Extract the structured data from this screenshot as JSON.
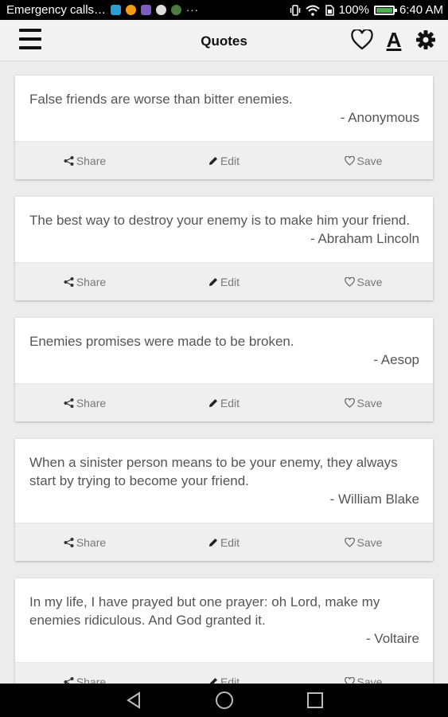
{
  "status_bar": {
    "notification_text": "Emergency calls…",
    "more": "···",
    "battery": "100%",
    "time": "6:40 AM",
    "battery_level": 1.0
  },
  "app_bar": {
    "title": "Quotes",
    "icons": [
      "menu-icon",
      "heart-icon",
      "font-icon",
      "gear-icon"
    ],
    "font_icon_label": "A"
  },
  "quotes": [
    {
      "text": "False friends are worse than bitter enemies.",
      "author": "- Anonymous"
    },
    {
      "text": "The best way to destroy your enemy is to make him your friend.",
      "author": "- Abraham Lincoln"
    },
    {
      "text": "Enemies promises were made to be broken.",
      "author": "- Aesop"
    },
    {
      "text": "When a sinister person means to be your enemy, they always start by trying to become your friend.",
      "author": "- William Blake"
    },
    {
      "text": "In my life, I have prayed but one prayer: oh Lord, make my enemies ridiculous. And God granted it.",
      "author": "- Voltaire"
    }
  ],
  "actions": {
    "share": "Share",
    "edit": "Edit",
    "save": "Save"
  },
  "colors": {
    "accent_battery": "#4caf50",
    "card_action_bg": "#efefef",
    "text": "#555555"
  }
}
